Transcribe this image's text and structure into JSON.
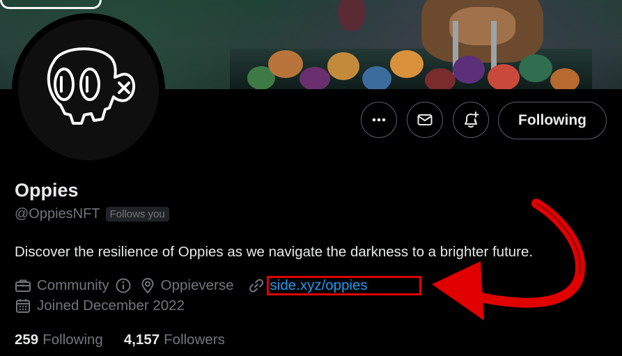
{
  "profile": {
    "name": "Oppies",
    "handle": "@OppiesNFT",
    "follows_you": "Follows you",
    "bio": "Discover the resilience of Oppies as we navigate the darkness to a brighter future.",
    "category": "Community",
    "location": "Oppieverse",
    "website": "side.xyz/oppies",
    "joined": "Joined December 2022"
  },
  "actions": {
    "more_icon": "more-dots-icon",
    "message_icon": "envelope-icon",
    "notify_icon": "bell-plus-icon",
    "following_label": "Following"
  },
  "stats": {
    "following_count": "259",
    "following_label": "Following",
    "followers_count": "4,157",
    "followers_label": "Followers"
  },
  "colors": {
    "background": "#000000",
    "text_primary": "#e7e9ea",
    "text_secondary": "#71767b",
    "link": "#1d9bf0",
    "highlight": "#e00000"
  }
}
